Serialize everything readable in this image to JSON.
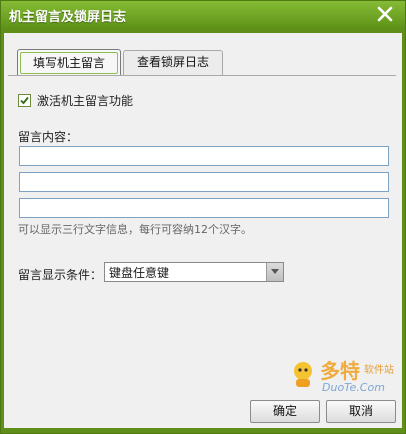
{
  "window": {
    "title": "机主留言及锁屏日志"
  },
  "tabs": [
    {
      "label": "填写机主留言",
      "active": true
    },
    {
      "label": "查看锁屏日志",
      "active": false
    }
  ],
  "form": {
    "activate_label": "激活机主留言功能",
    "activate_checked": true,
    "content_label": "留言内容：",
    "lines": [
      "",
      "",
      ""
    ],
    "hint": "可以显示三行文字信息，每行可容纳12个汉字。",
    "condition_label": "留言显示条件：",
    "condition_value": "键盘任意键"
  },
  "buttons": {
    "ok": "确定",
    "cancel": "取消"
  },
  "watermark": {
    "logo_text": "多特",
    "logo_sub": "软件站",
    "logo_url": "DuoTe.Com"
  },
  "colors": {
    "titlebar": "#6fa42a",
    "accent_green": "#8fbf4e",
    "input_border": "#7da2c6"
  }
}
